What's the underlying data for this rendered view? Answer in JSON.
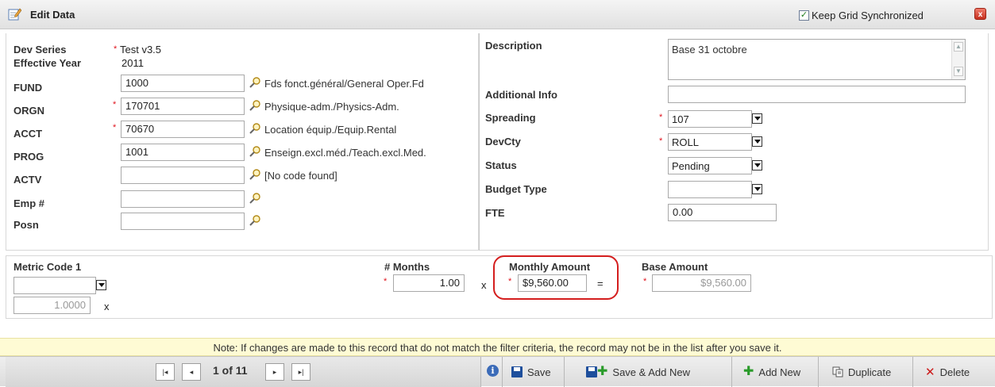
{
  "window": {
    "title": "Edit Data",
    "keep_sync_label": "Keep Grid Synchronized",
    "keep_sync_checked": true,
    "close_symbol": "x"
  },
  "left": {
    "dev_series": {
      "label": "Dev Series",
      "value": "Test v3.5"
    },
    "effective_year": {
      "label": "Effective Year",
      "value": "2011"
    },
    "fields": [
      {
        "label": "FUND",
        "value": "1000",
        "required": false,
        "desc": "Fds fonct.général/General Oper.Fd"
      },
      {
        "label": "ORGN",
        "value": "170701",
        "required": true,
        "desc": "Physique-adm./Physics-Adm."
      },
      {
        "label": "ACCT",
        "value": "70670",
        "required": true,
        "desc": "Location équip./Equip.Rental"
      },
      {
        "label": "PROG",
        "value": "1001",
        "required": false,
        "desc": "Enseign.excl.méd./Teach.excl.Med."
      },
      {
        "label": "ACTV",
        "value": "",
        "required": false,
        "desc": "[No code found]"
      },
      {
        "label": "Emp #",
        "value": "",
        "required": false,
        "desc": ""
      },
      {
        "label": "Posn",
        "value": "",
        "required": false,
        "desc": ""
      }
    ]
  },
  "right": {
    "description": {
      "label": "Description",
      "value": "Base 31 octobre"
    },
    "additional_info": {
      "label": "Additional Info",
      "value": ""
    },
    "spreading": {
      "label": "Spreading",
      "value": "107"
    },
    "devcty": {
      "label": "DevCty",
      "value": "ROLL"
    },
    "status": {
      "label": "Status",
      "value": "Pending"
    },
    "budget_type": {
      "label": "Budget Type",
      "value": ""
    },
    "fte": {
      "label": "FTE",
      "value": "0.00"
    }
  },
  "metrics": {
    "metric_code_label": "Metric Code 1",
    "metric_code_value": "",
    "metric_factor": "1.0000",
    "times_symbol": "x",
    "months_label": "# Months",
    "months_value": "1.00",
    "monthly_amount_label": "Monthly Amount",
    "monthly_amount_value": "$9,560.00",
    "equals_symbol": "=",
    "base_amount_label": "Base Amount",
    "base_amount_value": "$9,560.00"
  },
  "note": "Note: If changes are made to this record that do not match the filter criteria, the record may not be in the list after you save it.",
  "toolbar": {
    "page_indicator": "1 of 11",
    "save": "Save",
    "save_add_new": "Save & Add New",
    "add_new": "Add New",
    "duplicate": "Duplicate",
    "delete": "Delete",
    "info_symbol": "i"
  },
  "colors": {
    "required": "#e0141e",
    "highlight": "#d41e1e",
    "note_bg": "#fefbd4"
  }
}
